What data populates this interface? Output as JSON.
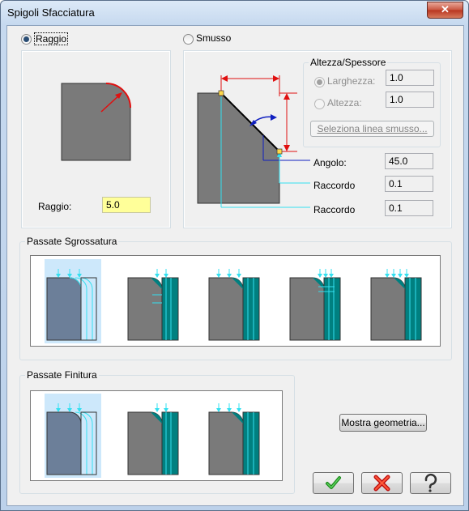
{
  "window": {
    "title": "Spigoli Sfacciatura",
    "close_symbol": "✕"
  },
  "raggio_option": {
    "label": "Raggio",
    "selected": true
  },
  "smusso_option": {
    "label": "Smusso",
    "selected": false
  },
  "raggio_field": {
    "label": "Raggio:",
    "value": "5.0"
  },
  "altezza_spessore": {
    "title": "Altezza/Spessore",
    "larghezza": {
      "label": "Larghezza:",
      "value": "1.0",
      "selected": true
    },
    "altezza": {
      "label": "Altezza:",
      "value": "1.0",
      "selected": false
    },
    "select_line_button": "Seleziona linea smusso..."
  },
  "angolo": {
    "label": "Angolo:",
    "value": "45.0"
  },
  "raccordo_1": {
    "label": "Raccordo",
    "value": "0.1"
  },
  "raccordo_2": {
    "label": "Raccordo",
    "value": "0.1"
  },
  "passate_sgrossatura": {
    "title": "Passate Sgrossatura",
    "options": 5,
    "selected_index": 0
  },
  "passate_finitura": {
    "title": "Passate Finitura",
    "options": 3,
    "selected_index": 0
  },
  "mostra_geometria_button": "Mostra geometria...",
  "colors": {
    "part_gray": "#7a7a7a",
    "teal": "#008080",
    "cyan": "#33e0f0",
    "red": "#e01010",
    "blue": "#1020c0",
    "selected_bg": "#cde8fb"
  },
  "icons": {
    "ok": "check-icon",
    "cancel": "x-icon",
    "help": "question-icon"
  }
}
